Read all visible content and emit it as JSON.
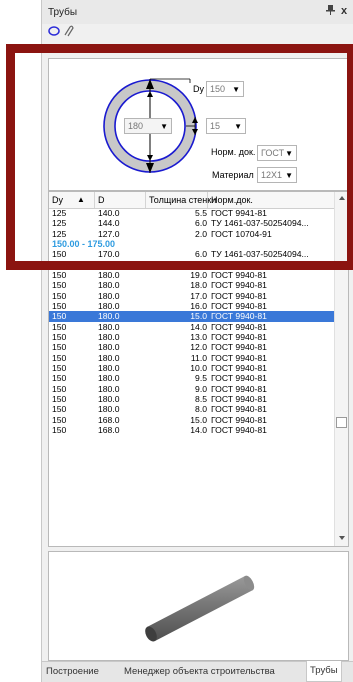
{
  "window": {
    "title": "Трубы",
    "pin_icon": "pin-icon",
    "close_label": "x"
  },
  "params": {
    "dy_label": "Dy",
    "dy_value": "150",
    "d_value": "180",
    "wall_value": "15",
    "norm_label": "Норм. док.",
    "norm_value": "ГОСТ",
    "material_label": "Материал",
    "material_value": "12X1"
  },
  "table": {
    "headers": [
      "Dy",
      "D",
      "Толщина стенки",
      "Норм.док."
    ],
    "sort_indicator": "▲",
    "rows_before": [
      [
        "125",
        "140.0",
        "5.5",
        "ГОСТ 9941-81"
      ],
      [
        "125",
        "144.0",
        "6.0",
        "ТУ 1461-037-50254094..."
      ],
      [
        "125",
        "127.0",
        "2.0",
        "ГОСТ 10704-91"
      ]
    ],
    "group_label": "150.00 - 175.00",
    "rows_after": [
      [
        "150",
        "170.0",
        "6.0",
        "ТУ 1461-037-50254094..."
      ],
      [
        "150",
        "180.0",
        "20.0",
        "ГОСТ 9940-81"
      ],
      [
        "150",
        "180.0",
        "19.0",
        "ГОСТ 9940-81"
      ],
      [
        "150",
        "180.0",
        "18.0",
        "ГОСТ 9940-81"
      ],
      [
        "150",
        "180.0",
        "17.0",
        "ГОСТ 9940-81"
      ],
      [
        "150",
        "180.0",
        "16.0",
        "ГОСТ 9940-81"
      ],
      [
        "150",
        "180.0",
        "15.0",
        "ГОСТ 9940-81"
      ],
      [
        "150",
        "180.0",
        "14.0",
        "ГОСТ 9940-81"
      ],
      [
        "150",
        "180.0",
        "13.0",
        "ГОСТ 9940-81"
      ],
      [
        "150",
        "180.0",
        "12.0",
        "ГОСТ 9940-81"
      ],
      [
        "150",
        "180.0",
        "11.0",
        "ГОСТ 9940-81"
      ],
      [
        "150",
        "180.0",
        "10.0",
        "ГОСТ 9940-81"
      ],
      [
        "150",
        "180.0",
        "9.5",
        "ГОСТ 9940-81"
      ],
      [
        "150",
        "180.0",
        "9.0",
        "ГОСТ 9940-81"
      ],
      [
        "150",
        "180.0",
        "8.5",
        "ГОСТ 9940-81"
      ],
      [
        "150",
        "180.0",
        "8.0",
        "ГОСТ 9940-81"
      ],
      [
        "150",
        "168.0",
        "15.0",
        "ГОСТ 9940-81"
      ],
      [
        "150",
        "168.0",
        "14.0",
        "ГОСТ 9940-81"
      ]
    ],
    "selected_row_index": 6
  },
  "tabs": [
    {
      "label": "Построение",
      "active": false
    },
    {
      "label": "Менеджер объекта строительства",
      "active": false
    },
    {
      "label": "Трубы",
      "active": true
    }
  ],
  "colors": {
    "highlight_border": "#8b1410",
    "pipe_ring": "#c8c8c8",
    "circle_stroke": "#1a1ad0",
    "selection": "#3a78d8",
    "group_text": "#2e9be0"
  }
}
